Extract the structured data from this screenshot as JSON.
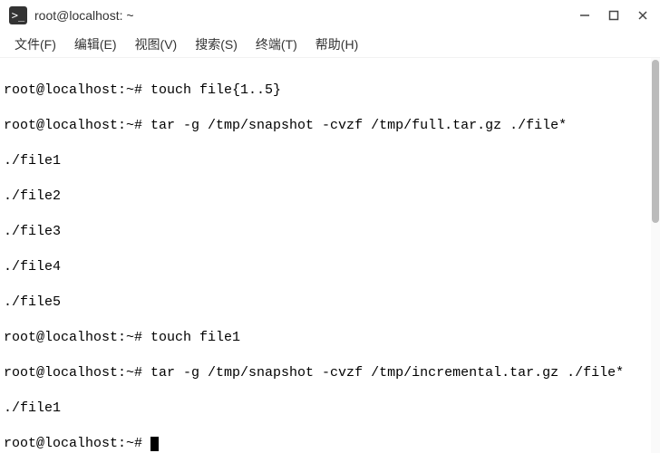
{
  "window": {
    "title": "root@localhost: ~",
    "icon_glyph": ">_"
  },
  "menu": {
    "items": [
      {
        "label": "文件(F)"
      },
      {
        "label": "编辑(E)"
      },
      {
        "label": "视图(V)"
      },
      {
        "label": "搜索(S)"
      },
      {
        "label": "终端(T)"
      },
      {
        "label": "帮助(H)"
      }
    ]
  },
  "terminal": {
    "lines": [
      "root@localhost:~# touch file{1..5}",
      "root@localhost:~# tar -g /tmp/snapshot -cvzf /tmp/full.tar.gz ./file*",
      "./file1",
      "./file2",
      "./file3",
      "./file4",
      "./file5",
      "root@localhost:~# touch file1",
      "root@localhost:~# tar -g /tmp/snapshot -cvzf /tmp/incremental.tar.gz ./file*",
      "./file1"
    ],
    "prompt": "root@localhost:~# "
  }
}
